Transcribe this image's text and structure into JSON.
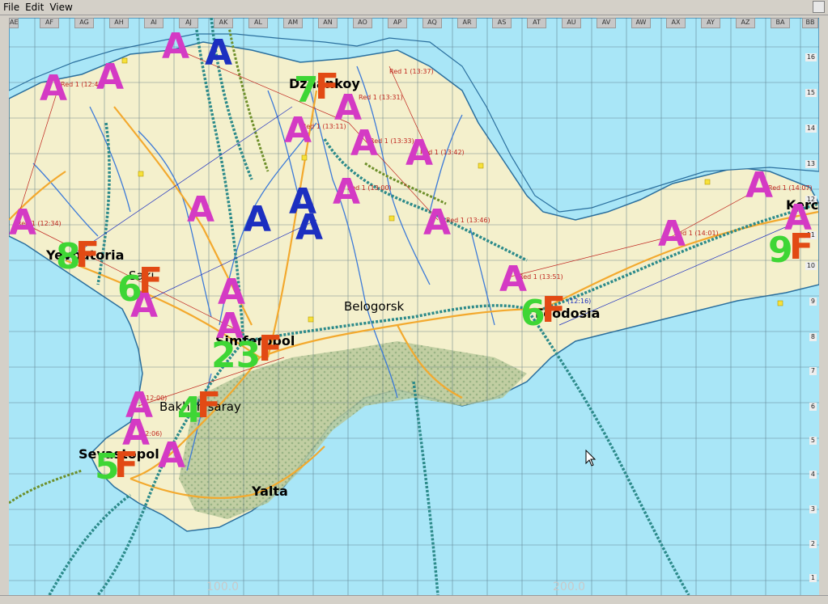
{
  "menu": [
    "File",
    "Edit",
    "View"
  ],
  "columns": [
    "AE",
    "AF",
    "AG",
    "AH",
    "AI",
    "AJ",
    "AK",
    "AL",
    "AM",
    "AN",
    "AO",
    "AP",
    "AQ",
    "AR",
    "AS",
    "AT",
    "AU",
    "AV",
    "AW",
    "AX",
    "AY",
    "AZ",
    "BA",
    "BB"
  ],
  "rows": [
    "16",
    "15",
    "14",
    "13",
    "12",
    "11",
    "10",
    "9",
    "8",
    "7",
    "6",
    "5",
    "4",
    "3",
    "2",
    "1"
  ],
  "cities": {
    "dzhankoy": "Dzhankoy",
    "yevpatoria": "Yevpatoria",
    "saki": "Saki",
    "simferopol": "Simferopol",
    "belogorsk": "Belogorsk",
    "feodosia": "Feodosia",
    "bakhchisaray": "Bakhchisaray",
    "sevastopol": "Sevastopol",
    "yalta": "Yalta",
    "kerch": "Kerch"
  },
  "markers": {
    "airfield": "A",
    "base_letter": "F",
    "numbers": [
      "7",
      "8",
      "6",
      "23",
      "4",
      "5",
      "6",
      "9"
    ]
  },
  "flight_labels": [
    "Red 1 (12:42)",
    "Red 1 (12:34)",
    "Red 1 (13:37)",
    "Red 1 (13:31)",
    "Red 1 (13:11)",
    "Red 1 (13:33)",
    "Red 1 (13:42)",
    "Red 1 (13:00)",
    "Red 1 (13:46)",
    "Red 1 (14:07)",
    "Red 1 (14:01)",
    "Red 1 (13:51)",
    "(12:16)",
    "(12:00)",
    "(12:06)"
  ],
  "scale_labels": [
    "100.0",
    "200.0"
  ],
  "colors": {
    "sea": "#a9e6f7",
    "land": "#f4f0cc",
    "roads": "#f3a92e",
    "rivers": "#3c7ad8",
    "rail": "#2c8a8a",
    "forest": "#9cb88a",
    "airfield_red": "#d43ac4",
    "airfield_blue": "#1c2fc0",
    "base_orange": "#e24a14",
    "count_green": "#3ed635"
  }
}
